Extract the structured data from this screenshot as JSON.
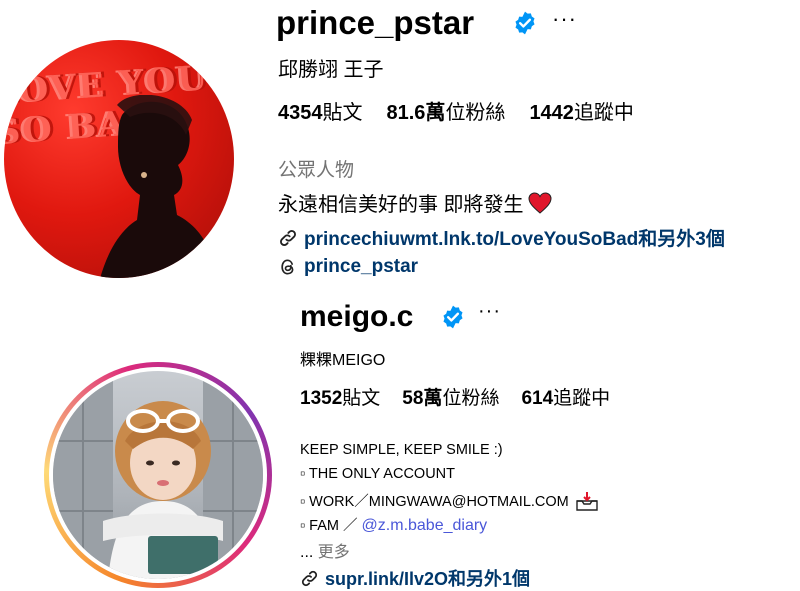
{
  "profile1": {
    "username": "prince_pstar",
    "display_name": "邱勝翊 王子",
    "stats": {
      "posts_value": "4354",
      "posts_label": "貼文",
      "followers_value": "81.6萬",
      "followers_label": "位粉絲",
      "following_value": "1442",
      "following_label": "追蹤中"
    },
    "category": "公眾人物",
    "bio": "永遠相信美好的事 即將發生",
    "link": "princechiuwmt.lnk.to/LoveYouSoBad和另外3個",
    "threads": "prince_pstar",
    "avatar_text": "LOVE YOU SO BAD"
  },
  "profile2": {
    "username": "meigo.c",
    "display_name": "粿粿MEIGO",
    "stats": {
      "posts_value": "1352",
      "posts_label": "貼文",
      "followers_value": "58萬",
      "followers_label": "位粉絲",
      "following_value": "614",
      "following_label": "追蹤中"
    },
    "bio_lines": [
      "KEEP SIMPLE, KEEP SMILE :)",
      "▫︎ THE ONLY ACCOUNT",
      "▫︎ WORK／MINGWAWA@HOTMAIL.COM",
      "▫︎ FAM ／"
    ],
    "mention": "@z.m.babe_diary",
    "more_prefix": "... ",
    "more_label": "更多",
    "link": "supr.link/Ilv2O和另外1個"
  },
  "colors": {
    "verified": "#0095f6",
    "muted": "#737373",
    "link": "#00376b",
    "mention": "#4a57d8",
    "heart": "#e0162b"
  },
  "icons": [
    "verified-badge-icon",
    "more-options-icon",
    "link-icon",
    "threads-icon",
    "heart-icon",
    "inbox-tray-icon"
  ]
}
